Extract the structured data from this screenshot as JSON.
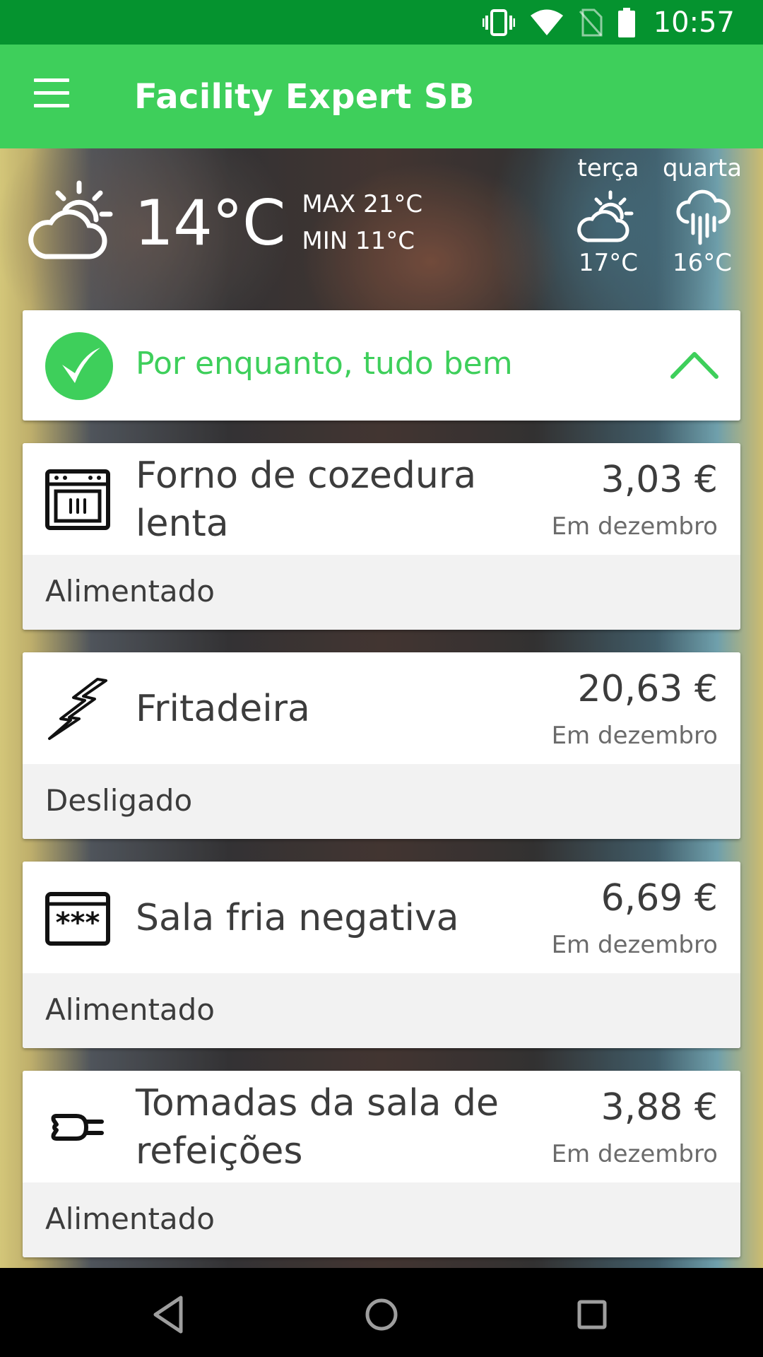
{
  "status_bar": {
    "time": "10:57",
    "icons": [
      "vibrate-icon",
      "wifi-icon",
      "no-sim-icon",
      "battery-icon"
    ]
  },
  "app_bar": {
    "title": "Facility Expert SB",
    "menu_icon": "menu-icon"
  },
  "weather": {
    "current": {
      "temperature": "14°C",
      "max": "MAX 21°C",
      "min": "MIN 11°C",
      "icon": "partly-cloudy-icon"
    },
    "forecast": [
      {
        "day": "terça",
        "temperature": "17°C",
        "icon": "partly-cloudy-icon"
      },
      {
        "day": "quarta",
        "temperature": "16°C",
        "icon": "rain-icon"
      }
    ]
  },
  "status": {
    "text": "Por enquanto, tudo bem",
    "icon": "check-circle-icon",
    "color": "#3ecf5b"
  },
  "devices": [
    {
      "name": "Forno de cozedura lenta",
      "price": "3,03 €",
      "period": "Em dezembro",
      "state": "Alimentado",
      "icon": "oven-icon"
    },
    {
      "name": "Fritadeira",
      "price": "20,63 €",
      "period": "Em dezembro",
      "state": "Desligado",
      "icon": "lightning-icon"
    },
    {
      "name": "Sala fria negativa",
      "price": "6,69 €",
      "period": "Em dezembro",
      "state": "Alimentado",
      "icon": "freezer-icon"
    },
    {
      "name": "Tomadas da sala de refeições",
      "price": "3,88 €",
      "period": "Em dezembro",
      "state": "Alimentado",
      "icon": "plug-icon"
    }
  ],
  "nav": [
    "back-icon",
    "home-icon",
    "recents-icon"
  ],
  "colors": {
    "status_bar": "#05932f",
    "app_bar": "#3ecf5b",
    "accent": "#3ecf5b"
  }
}
